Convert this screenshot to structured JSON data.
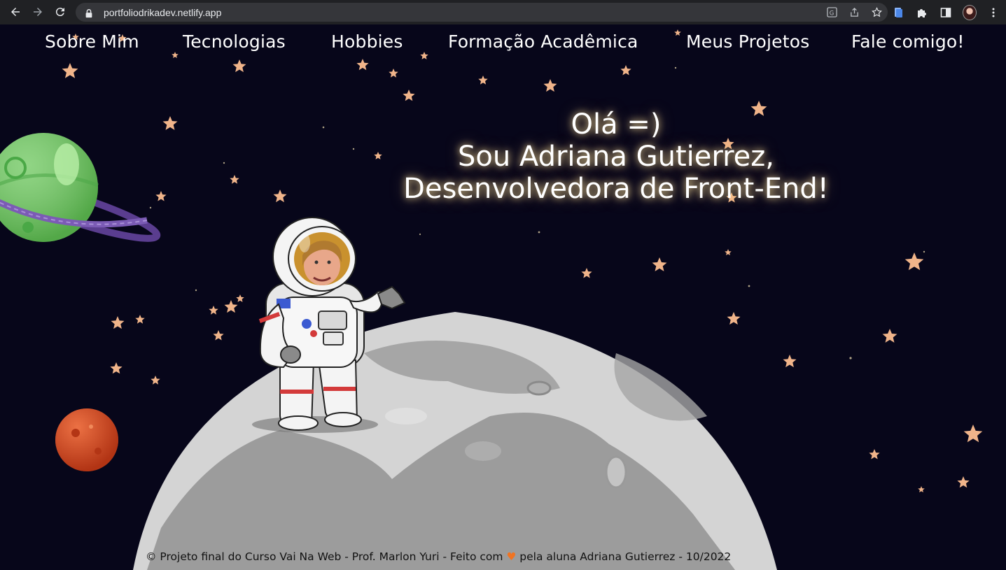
{
  "browser": {
    "url": "portfoliodrikadev.netlify.app",
    "icons": [
      "back-icon",
      "forward-icon",
      "reload-icon",
      "lock-icon",
      "translate-icon",
      "share-icon",
      "bookmark-star-icon",
      "extension-doc-icon",
      "puzzle-icon",
      "side-panel-icon",
      "profile-avatar",
      "kebab-menu-icon"
    ]
  },
  "nav": {
    "items": [
      "Sobre Mim",
      "Tecnologias",
      "Hobbies",
      "Formação Acadêmica",
      "Meus Projetos",
      "Fale comigo!"
    ]
  },
  "hero": {
    "line1": "Olá =)",
    "line2": "Sou Adriana Gutierrez,",
    "line3": "Desenvolvedora de Front-End!"
  },
  "footer": {
    "before_heart": "© Projeto final do Curso Vai Na Web - Prof. Marlon Yuri - Feito com",
    "heart": "♥",
    "after_heart": "pela aluna Adriana Gutierrez - 10/2022"
  },
  "colors": {
    "background": "#07061a",
    "star": "#f0b48a",
    "text": "#ffffff",
    "heart": "#f07422",
    "planet_green": "#7ed66a",
    "ring_purple": "#7b5bb5",
    "planet_red": "#d9481e",
    "moon": "#cfcfcf"
  }
}
